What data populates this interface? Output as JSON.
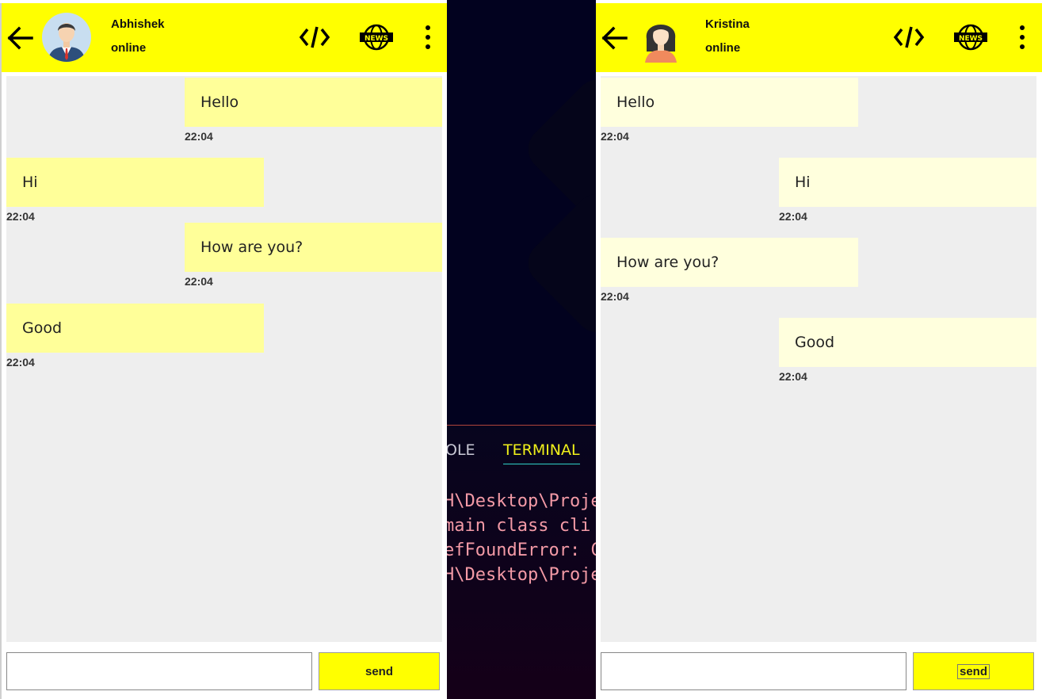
{
  "ide": {
    "tabs": [
      "OLE",
      "TERMINAL"
    ],
    "terminal_lines": [
      "H\\Desktop\\Proje",
      " main class cli",
      "efFoundError: C",
      "H\\Desktop\\Proje"
    ]
  },
  "chat_left": {
    "user_name": "Abhishek",
    "status": "online",
    "send_label": "send",
    "messages": [
      {
        "text": "Hello",
        "time": "22:04"
      },
      {
        "text": "Hi",
        "time": "22:04"
      },
      {
        "text": "How are you?",
        "time": "22:04"
      },
      {
        "text": "Good",
        "time": "22:04"
      }
    ]
  },
  "chat_right": {
    "user_name": "Kristina",
    "status": "online",
    "send_label": "send",
    "messages": [
      {
        "text": "Hello",
        "time": "22:04"
      },
      {
        "text": "Hi",
        "time": "22:04"
      },
      {
        "text": "How are you?",
        "time": "22:04"
      },
      {
        "text": "Good",
        "time": "22:04"
      }
    ]
  },
  "icons": {
    "back": "arrow-left-icon",
    "code": "code-icon",
    "news": "news-globe-icon",
    "more": "more-vertical-icon"
  },
  "colors": {
    "header": "#ffff00",
    "bubble_left_window": "#ffff99",
    "bubble_right_window": "#ffffdd",
    "chat_background": "#eeeeee",
    "terminal_text": "#f39aa6"
  }
}
